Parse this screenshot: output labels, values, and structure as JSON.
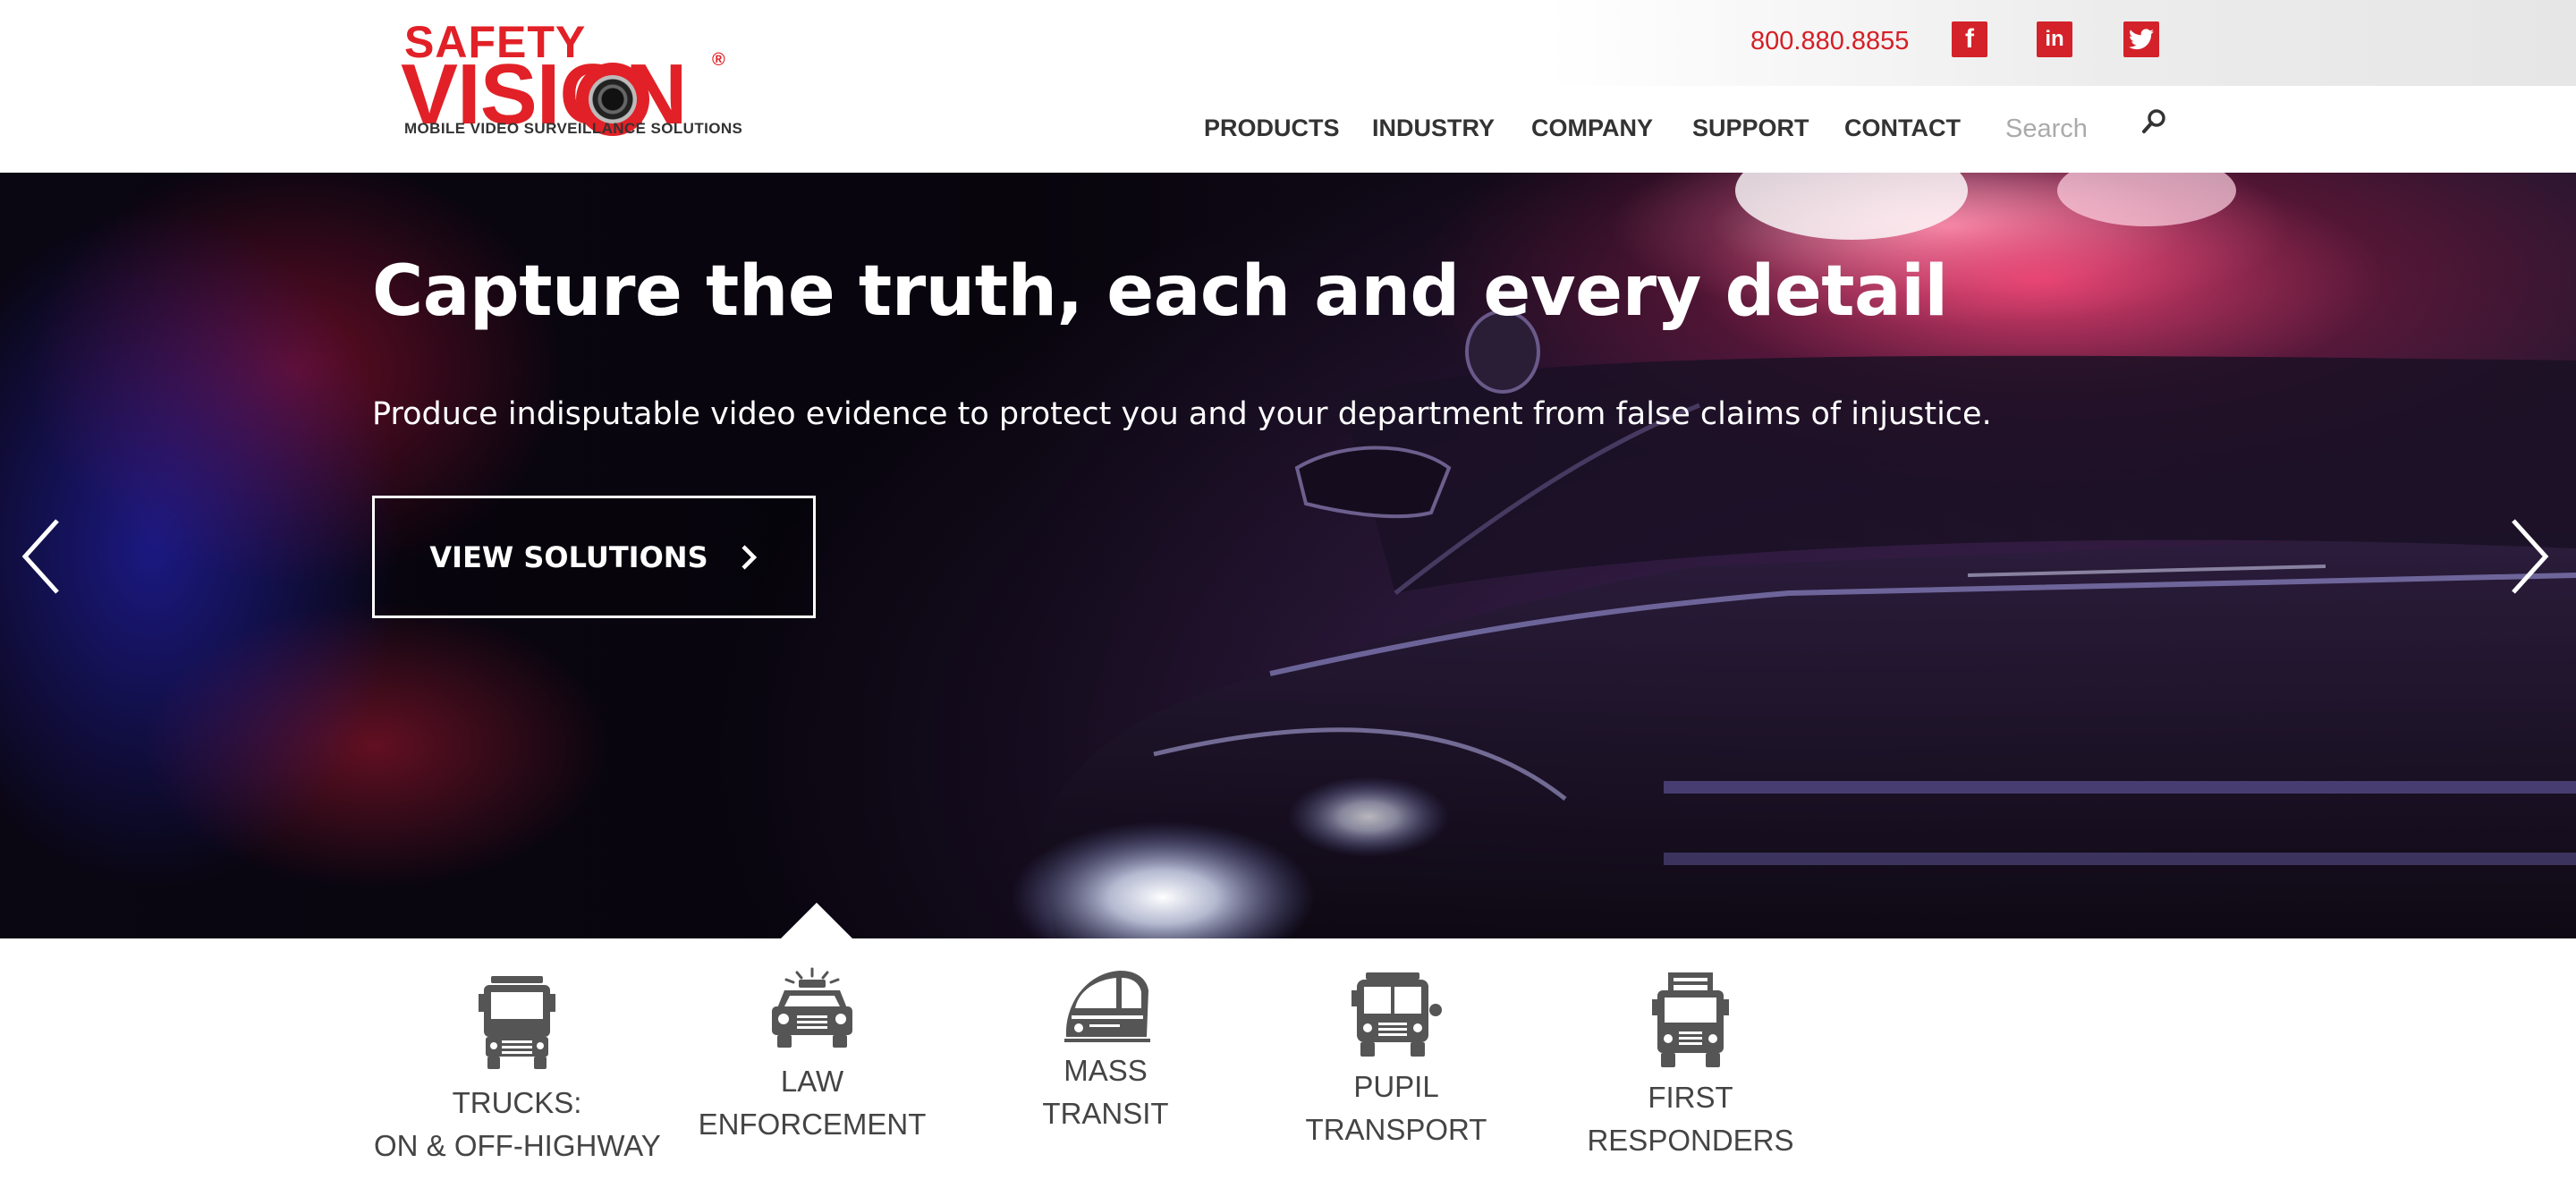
{
  "header": {
    "logo": {
      "brand_top": "SAFETY",
      "brand_main": "VISION",
      "registered": "®",
      "tagline": "MOBILE VIDEO SURVEILLANCE SOLUTIONS"
    },
    "phone": "800.880.8855",
    "social": [
      {
        "name": "facebook",
        "glyph": "f",
        "icon": "facebook-icon"
      },
      {
        "name": "linkedin",
        "glyph": "in",
        "icon": "linkedin-icon"
      },
      {
        "name": "twitter",
        "glyph": "",
        "icon": "twitter-icon"
      }
    ],
    "nav": [
      "PRODUCTS",
      "INDUSTRY",
      "COMPANY",
      "SUPPORT",
      "CONTACT"
    ],
    "search": {
      "placeholder": "Search",
      "icon": "search-icon"
    }
  },
  "hero": {
    "title": "Capture the truth, each and every detail",
    "subtitle": "Produce indisputable video evidence to protect you and your department from false claims of injustice.",
    "cta_label": "VIEW SOLUTIONS",
    "prev_icon": "chevron-left-icon",
    "next_icon": "chevron-right-icon"
  },
  "categories": [
    {
      "line1": "TRUCKS:",
      "line2": "ON & OFF-HIGHWAY",
      "icon": "truck-icon"
    },
    {
      "line1": "LAW",
      "line2": "ENFORCEMENT",
      "icon": "police-car-icon",
      "selected": true
    },
    {
      "line1": "MASS",
      "line2": "TRANSIT",
      "icon": "train-icon"
    },
    {
      "line1": "PUPIL",
      "line2": "TRANSPORT",
      "icon": "school-bus-icon"
    },
    {
      "line1": "FIRST",
      "line2": "RESPONDERS",
      "icon": "fire-truck-icon"
    }
  ],
  "colors": {
    "brand_red": "#e12127",
    "nav_text": "#333333",
    "icon_gray": "#555555"
  }
}
